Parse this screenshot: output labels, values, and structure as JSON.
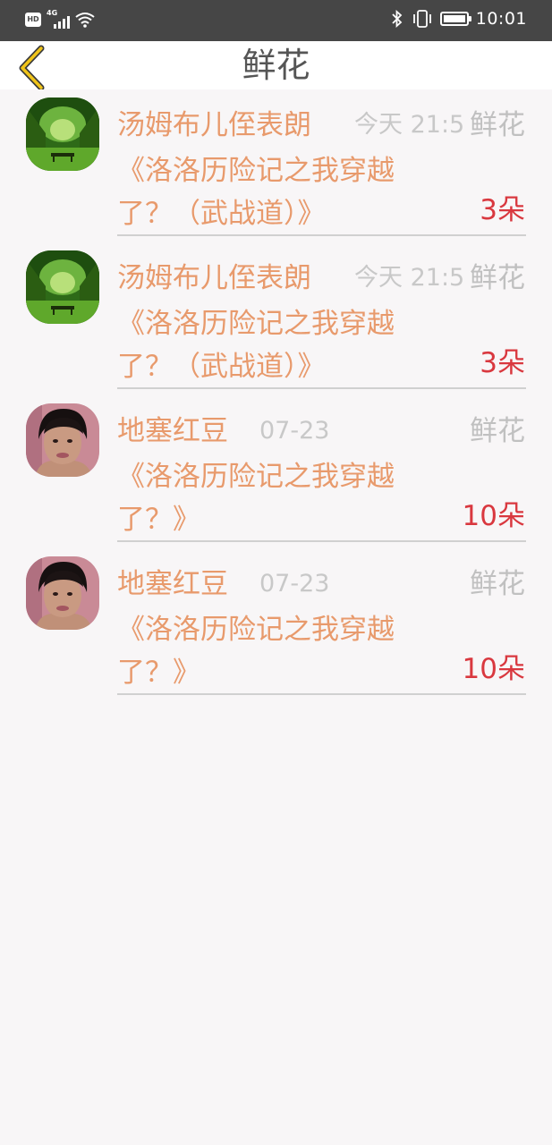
{
  "status_bar": {
    "hd_label": "HD",
    "network_label": "4G",
    "time": "10:01",
    "icons": [
      "hd-icon",
      "signal-4g-icon",
      "wifi-icon",
      "bluetooth-icon",
      "vibrate-icon",
      "battery-icon"
    ]
  },
  "nav": {
    "title": "鲜花",
    "back_icon": "chevron-left-icon",
    "accent": "#f0c419"
  },
  "colors": {
    "name": "#e89a6c",
    "time": "#c8c8c8",
    "kind": "#c0c0c0",
    "count": "#d9383f",
    "background": "#f8f6f7"
  },
  "items": [
    {
      "user": "汤姆布儿侄表朗",
      "time": "今天 21:5",
      "kind": "鲜花",
      "book": "《洛洛历险记之我穿越了？（武战道）》",
      "count": "3朵",
      "avatar": "forest-avatar"
    },
    {
      "user": "汤姆布儿侄表朗",
      "time": "今天 21:5",
      "kind": "鲜花",
      "book": "《洛洛历险记之我穿越了？（武战道）》",
      "count": "3朵",
      "avatar": "forest-avatar"
    },
    {
      "user": "地塞红豆",
      "time": "07-23",
      "kind": "鲜花",
      "book": "《洛洛历险记之我穿越了？》",
      "count": "10朵",
      "avatar": "person-avatar"
    },
    {
      "user": "地塞红豆",
      "time": "07-23",
      "kind": "鲜花",
      "book": "《洛洛历险记之我穿越了？》",
      "count": "10朵",
      "avatar": "person-avatar"
    }
  ]
}
